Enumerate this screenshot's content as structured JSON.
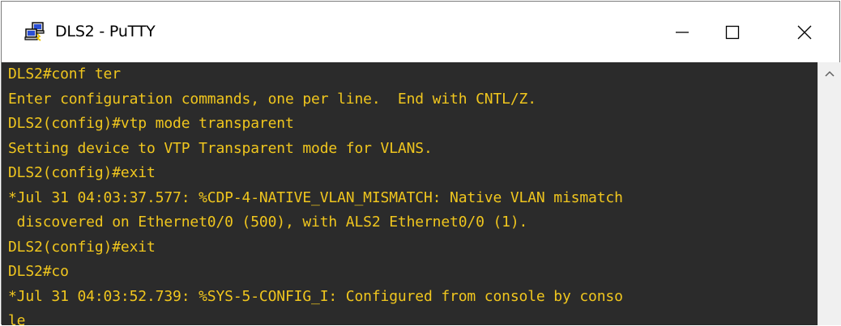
{
  "window": {
    "title": "DLS2 - PuTTY",
    "icon": "putty-computers-icon",
    "controls": [
      "minimize-icon",
      "maximize-icon",
      "close-icon"
    ]
  },
  "terminal": {
    "background": "#2b2b2b",
    "text_color": "#f0c61e",
    "lines": [
      "DLS2#conf ter",
      "Enter configuration commands, one per line.  End with CNTL/Z.",
      "DLS2(config)#vtp mode transparent",
      "Setting device to VTP Transparent mode for VLANS.",
      "DLS2(config)#exit",
      "*Jul 31 04:03:37.577: %CDP-4-NATIVE_VLAN_MISMATCH: Native VLAN mismatch",
      " discovered on Ethernet0/0 (500), with ALS2 Ethernet0/0 (1).",
      "DLS2(config)#exit",
      "DLS2#co",
      "*Jul 31 04:03:52.739: %SYS-5-CONFIG_I: Configured from console by conso",
      "le"
    ]
  },
  "scrollbar": {
    "up_arrow": "chevron-up-icon"
  }
}
